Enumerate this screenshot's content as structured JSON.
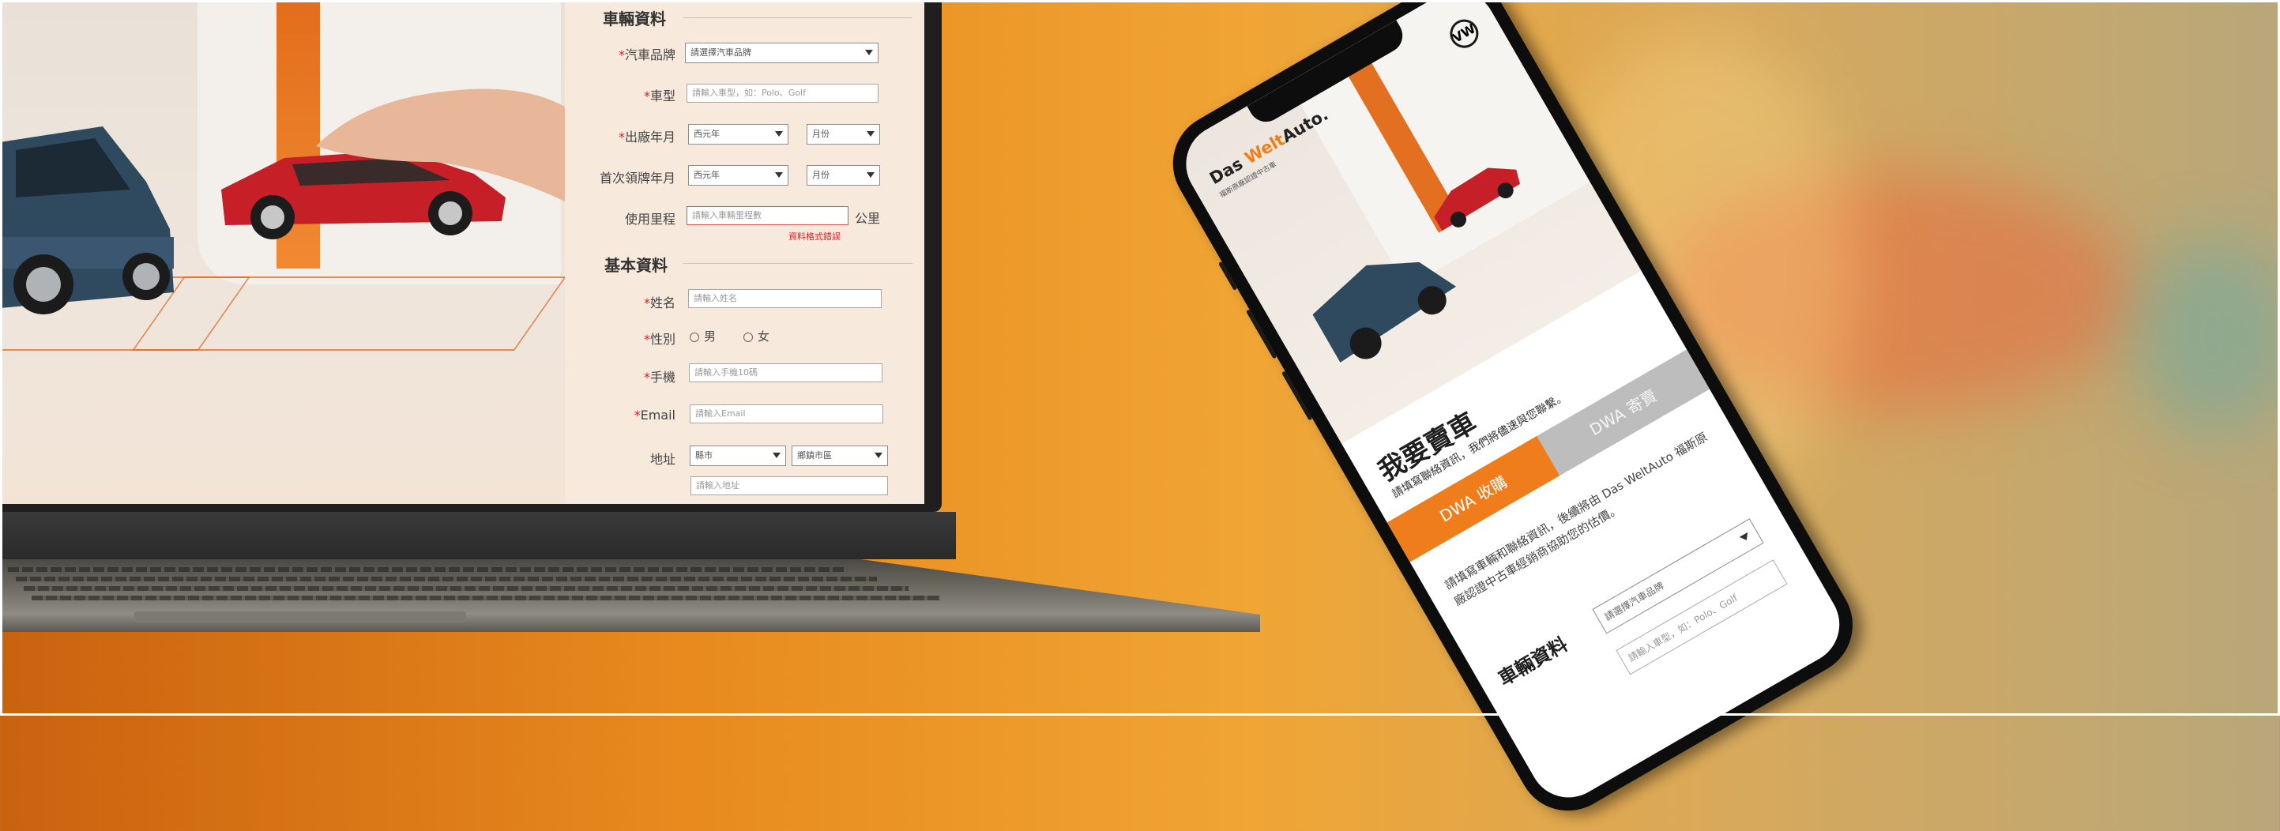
{
  "laptop": {
    "form": {
      "section_vehicle": "車輛資料",
      "brand": {
        "label": "汽車品牌",
        "value": "請選擇汽車品牌"
      },
      "model": {
        "label": "車型",
        "placeholder": "請輸入車型，如：Polo、Golf"
      },
      "build_date": {
        "label": "出廠年月",
        "year": "西元年",
        "month": "月份"
      },
      "registration_date": {
        "label": "首次領牌年月",
        "year": "西元年",
        "month": "月份"
      },
      "mileage": {
        "label": "使用里程",
        "placeholder": "請輸入車輛里程數",
        "unit": "公里",
        "error": "資料格式錯誤"
      },
      "section_basic": "基本資料",
      "name": {
        "label": "姓名",
        "placeholder": "請輸入姓名"
      },
      "gender": {
        "label": "性別",
        "male": "男",
        "female": "女"
      },
      "mobile": {
        "label": "手機",
        "placeholder": "請輸入手機10碼"
      },
      "email": {
        "label": "Email",
        "placeholder": "請輸入Email"
      },
      "address": {
        "label": "地址",
        "city": "縣市",
        "district": "鄉鎮市區",
        "placeholder": "請輸入地址"
      },
      "required_mark": "*"
    }
  },
  "phone": {
    "logo_das": "Das ",
    "logo_welt": "Welt",
    "logo_auto": "Auto.",
    "logo_sub": "福斯原廠認證中古車",
    "vw_badge": "VW",
    "title": "我要賣車",
    "subtitle": "請填寫聯絡資訊，我們將儘速與您聯繫。",
    "tab_active": "DWA 收購",
    "tab_inactive": "DWA 寄賣",
    "intro": "請填寫車輛和聯絡資訊，後續將由 Das WeltAuto 福斯原廠認證中古車經銷商協助您的估價。",
    "section_vehicle": "車輛資料",
    "brand_select": "請選擇汽車品牌",
    "model_placeholder": "請輸入車型，如：Polo、Golf"
  }
}
